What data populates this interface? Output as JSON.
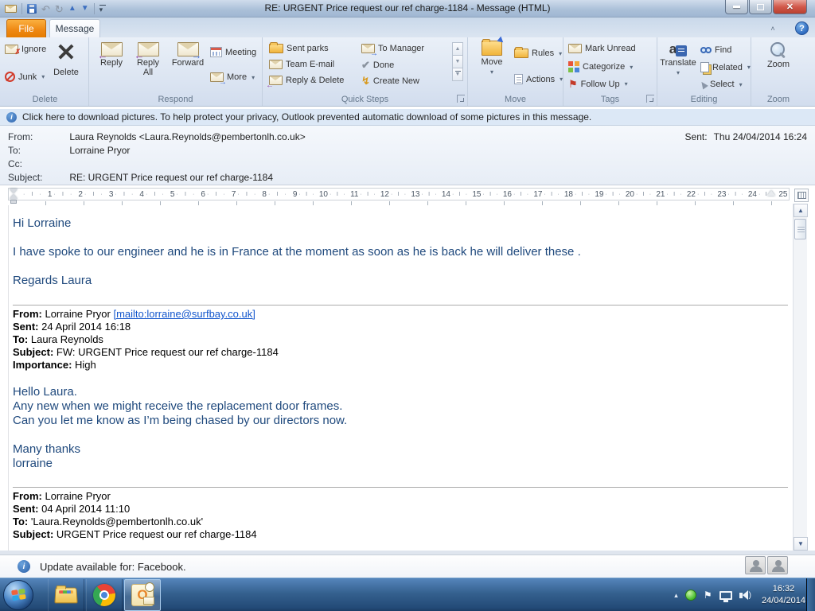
{
  "colors": {
    "file_tab_orange": "#ef8a15",
    "body_text_blue": "#1f497d",
    "link_blue": "#1155cc",
    "infobar_blue": "#dce8f6",
    "taskbar_blue": "#35618f",
    "close_button_red": "#d2594b"
  },
  "titlebar": {
    "title": "RE: URGENT Price request our ref charge-1184 - Message (HTML)"
  },
  "icons": {
    "minimize": "",
    "close_x": "✕",
    "help": "?",
    "collapse_ribbon": "˄",
    "undo": "↶",
    "redo": "↻",
    "prev_item": "▲",
    "next_item": "▼",
    "qat_more": "▾",
    "delete_x": "✕",
    "done_check": "✔",
    "create_new_bolt": "↯",
    "follow_up_flag": "⚑",
    "scroll_up": "▲",
    "scroll_down": "▼",
    "tray_chevron": "▴",
    "tray_flag": "⚑",
    "speaker_wave": ")",
    "outlook_o": "O"
  },
  "tabs": {
    "file": "File",
    "message": "Message"
  },
  "ribbon": {
    "groups": {
      "delete": {
        "label": "Delete",
        "ignore": "Ignore",
        "junk": "Junk",
        "del": "Delete"
      },
      "respond": {
        "label": "Respond",
        "reply": "Reply",
        "reply_all": "Reply All",
        "forward": "Forward",
        "meeting": "Meeting",
        "more": "More"
      },
      "quick_steps": {
        "label": "Quick Steps",
        "items": [
          "Sent parks",
          "Team E-mail",
          "Reply & Delete",
          "To Manager",
          "Done",
          "Create New"
        ]
      },
      "move": {
        "label": "Move",
        "move": "Move",
        "rules": "Rules",
        "actions": "Actions"
      },
      "tags": {
        "label": "Tags",
        "mark_unread": "Mark Unread",
        "categorize": "Categorize",
        "follow_up": "Follow Up"
      },
      "editing": {
        "label": "Editing",
        "translate": "Translate",
        "find": "Find",
        "related": "Related",
        "select": "Select"
      },
      "zoom": {
        "label": "Zoom",
        "zoom": "Zoom"
      }
    }
  },
  "infobar": {
    "text": "Click here to download pictures. To help protect your privacy, Outlook prevented automatic download of some pictures in this message."
  },
  "header": {
    "from_label": "From:",
    "from_value": "Laura Reynolds <Laura.Reynolds@pembertonlh.co.uk>",
    "sent_label": "Sent:",
    "sent_value": "Thu 24/04/2014 16:24",
    "to_label": "To:",
    "to_value": "Lorraine Pryor",
    "cc_label": "Cc:",
    "cc_value": "",
    "subject_label": "Subject:",
    "subject_value": "RE: URGENT Price request our ref charge-1184"
  },
  "ruler": {
    "numbers": [
      "1",
      "2",
      "3",
      "4",
      "5",
      "6",
      "7",
      "8",
      "9",
      "10",
      "11",
      "12",
      "13",
      "14",
      "15",
      "16",
      "17",
      "18",
      "19",
      "20",
      "21",
      "22",
      "23",
      "24",
      "25"
    ],
    "tick_marks": [
      "·",
      "I",
      "·"
    ]
  },
  "message": {
    "greeting": "Hi Lorraine",
    "para1": "I have spoke to our engineer and he is in France at the moment as soon as he is back he will deliver these .",
    "signoff": "Regards Laura",
    "quote1": {
      "from_label": "From:",
      "from_name": "Lorraine Pryor ",
      "from_link": "[mailto:lorraine@surfbay.co.uk]",
      "sent_label": "Sent:",
      "sent_value": "24 April 2014 16:18",
      "to_label": "To:",
      "to_value": "Laura Reynolds",
      "subject_label": "Subject:",
      "subject_value": "FW: URGENT Price request our ref charge-1184",
      "importance_label": "Importance:",
      "importance_value": "High"
    },
    "reply2": {
      "line1": "Hello Laura.",
      "line2": "Any new when we might receive the replacement door frames.",
      "line3": "Can you let me know as I’m being chased by our directors now.",
      "thanks": "Many thanks",
      "name": "lorraine"
    },
    "quote2": {
      "from_label": "From:",
      "from_value": "Lorraine Pryor",
      "sent_label": "Sent:",
      "sent_value": "04 April 2014 11:10",
      "to_label": "To:",
      "to_value": "'Laura.Reynolds@pembertonlh.co.uk'",
      "subject_label": "Subject:",
      "subject_value": "URGENT Price request our ref charge-1184"
    }
  },
  "statusbar": {
    "text": "Update available for: Facebook."
  },
  "taskbar": {
    "time": "16:32",
    "date": "24/04/2014"
  }
}
